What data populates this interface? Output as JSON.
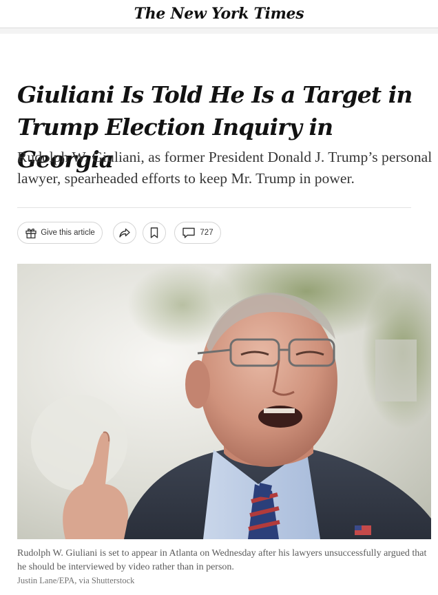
{
  "masthead": {
    "logo_text": "The New York Times"
  },
  "article": {
    "headline_line1": "Giuliani Is Told He Is a Target in",
    "headline_line2": "Trump Election Inquiry in Georgia",
    "summary": "Rudolph W. Giuliani, as former President Donald J. Trump’s personal lawyer, spearheaded efforts to keep Mr. Trump in power."
  },
  "toolbar": {
    "gift_label": "Give this article",
    "gift_icon": "gift-icon",
    "share_icon": "share-arrow-icon",
    "save_icon": "bookmark-icon",
    "comment_icon": "comment-bubble-icon",
    "comment_count": "727"
  },
  "photo": {
    "caption": "Rudolph W. Giuliani is set to appear in Atlanta on Wednesday after his lawyers unsuccessfully argued that he should be interviewed by video rather than in person.",
    "credit": "Justin Lane/EPA, via Shutterstock"
  },
  "colors": {
    "text": "#121212",
    "summary": "#363636",
    "caption": "#5a5a5a",
    "border": "#d5d5d5"
  }
}
